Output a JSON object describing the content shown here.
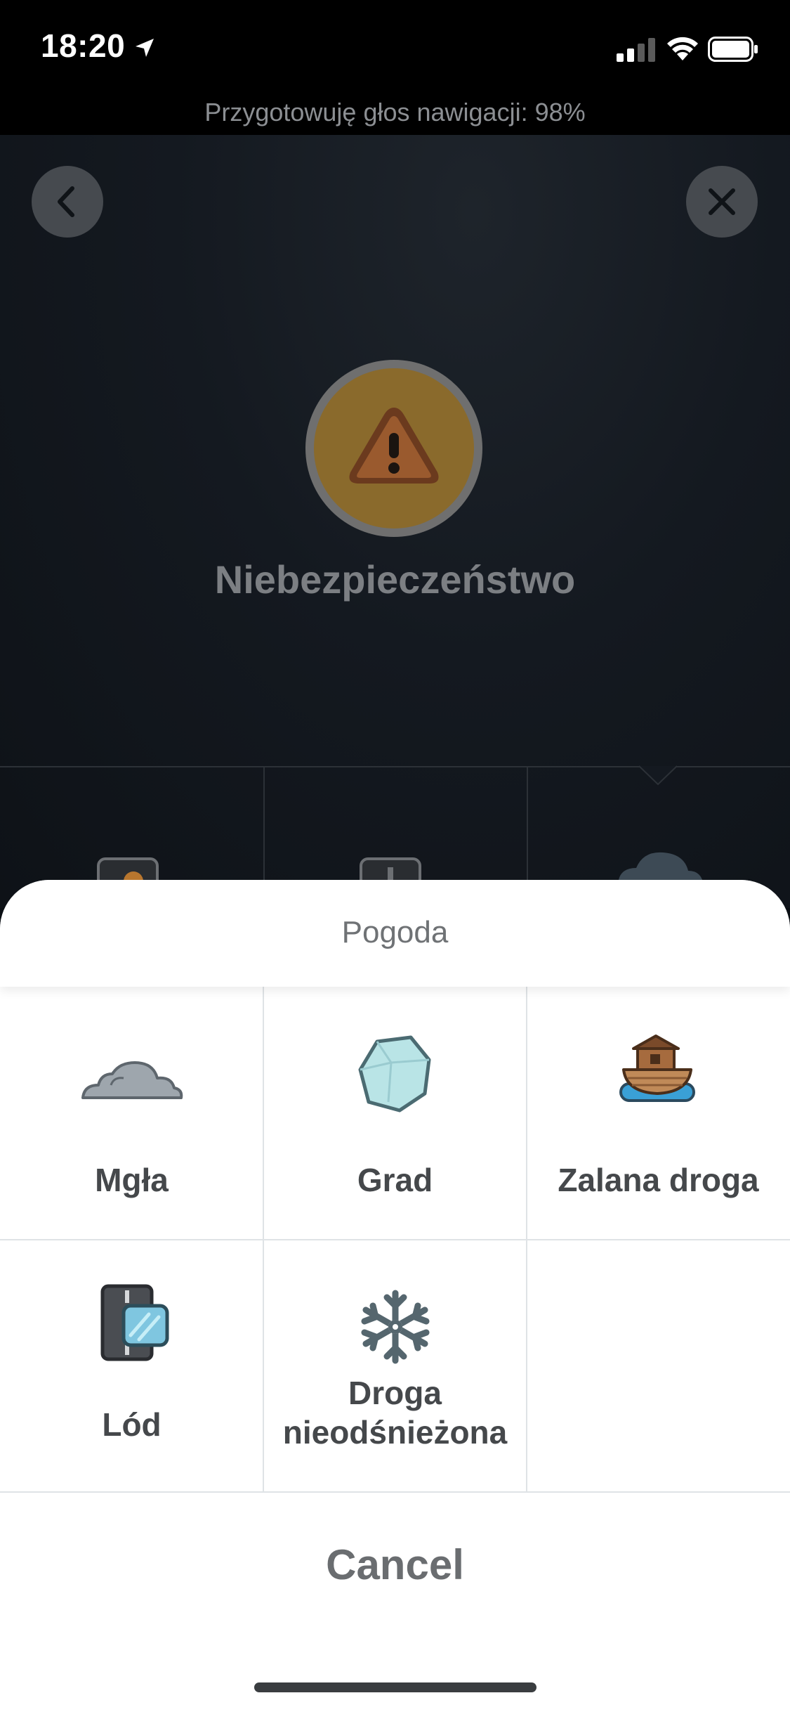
{
  "status_bar": {
    "time": "18:20",
    "icons": [
      "location-arrow-icon",
      "signal-icon",
      "wifi-icon",
      "battery-icon"
    ]
  },
  "banner": {
    "text": "Przygotowuję głos nawigacji: 98%"
  },
  "header": {
    "back_icon": "chevron-left-icon",
    "close_icon": "close-icon"
  },
  "hazard": {
    "icon": "warning-triangle-icon",
    "title": "Niebezpieczeństwo",
    "color": "#8a6a2c"
  },
  "sheet": {
    "title": "Pogoda",
    "items": [
      {
        "label": "Mgła",
        "icon": "fog-cloud-icon"
      },
      {
        "label": "Grad",
        "icon": "hail-ice-icon"
      },
      {
        "label": "Zalana droga",
        "icon": "flooded-road-ark-icon"
      },
      {
        "label": "Lód",
        "icon": "ice-road-icon"
      },
      {
        "label_line1": "Droga",
        "label_line2": "nieodśnieżona",
        "icon": "snowflake-icon"
      }
    ],
    "cancel_label": "Cancel"
  }
}
